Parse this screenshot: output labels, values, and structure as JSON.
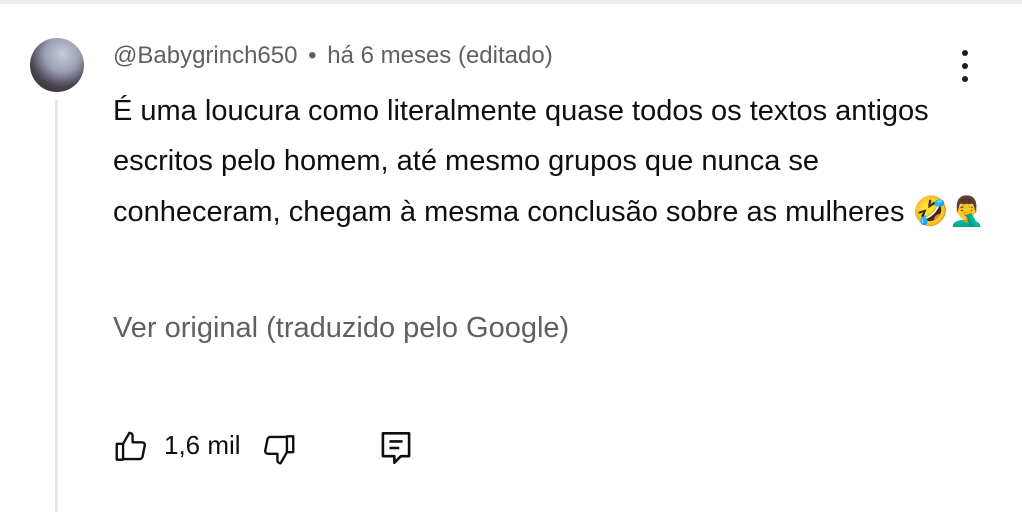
{
  "comment": {
    "author": "@Babygrinch650",
    "separator": "•",
    "age": "há 6 meses (editado)",
    "text": "É uma loucura como literalmente quase todos os textos antigos escritos pelo homem, até mesmo grupos que nunca se conheceram, chegam à mesma conclusão sobre as mulheres",
    "emojis": "🤣🤦‍♂️",
    "translation_link": "Ver original (traduzido pelo Google)",
    "like_count": "1,6 mil"
  },
  "icons": {
    "avatar": "avatar",
    "more": "kebab-menu-icon",
    "like": "thumbs-up-icon",
    "dislike": "thumbs-down-icon",
    "reply": "reply-comment-icon"
  },
  "colors": {
    "text_primary": "#0f0f0f",
    "text_secondary": "#606060",
    "thread_line": "#e6e6e6"
  }
}
